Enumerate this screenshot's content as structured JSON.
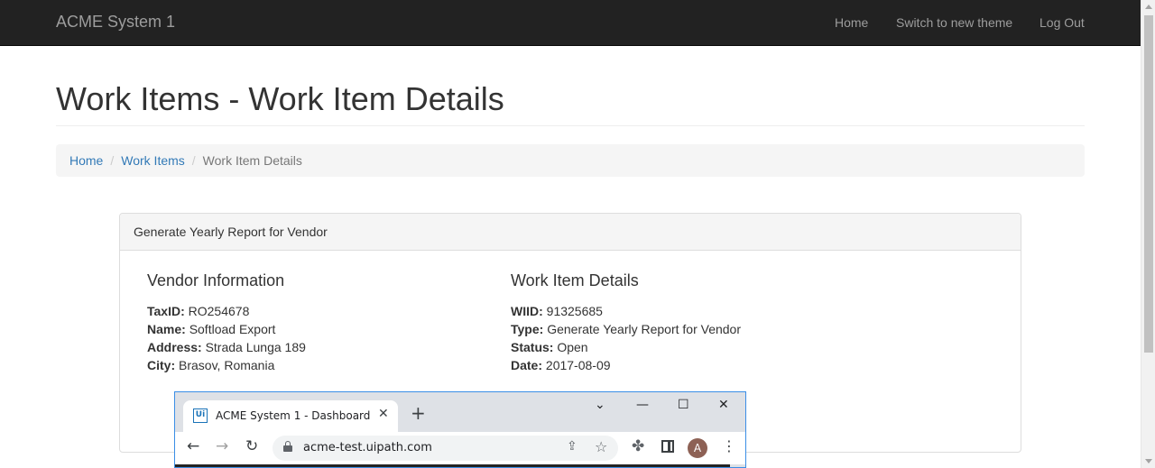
{
  "navbar": {
    "brand": "ACME System 1",
    "links": [
      "Home",
      "Switch to new theme",
      "Log Out"
    ]
  },
  "page": {
    "title": "Work Items - Work Item Details"
  },
  "breadcrumb": {
    "items": [
      "Home",
      "Work Items"
    ],
    "separator": "/",
    "active": "Work Item Details"
  },
  "panel": {
    "heading": "Generate Yearly Report for Vendor",
    "vendor": {
      "title": "Vendor Information",
      "rows": [
        {
          "label": "TaxID:",
          "value": "RO254678"
        },
        {
          "label": "Name:",
          "value": "Softload Export"
        },
        {
          "label": "Address:",
          "value": "Strada Lunga 189"
        },
        {
          "label": "City:",
          "value": "Brasov, Romania"
        }
      ]
    },
    "details": {
      "title": "Work Item Details",
      "rows": [
        {
          "label": "WIID:",
          "value": "91325685"
        },
        {
          "label": "Type:",
          "value": "Generate Yearly Report for Vendor"
        },
        {
          "label": "Status:",
          "value": "Open"
        },
        {
          "label": "Date:",
          "value": "2017-08-09"
        }
      ]
    }
  },
  "browser": {
    "tab_favicon": "Ui",
    "tab_title": "ACME System 1 - Dashboard",
    "url": "acme-test.uipath.com",
    "profile_initial": "A"
  },
  "colors": {
    "navbar_bg": "#222222",
    "link": "#337ab7",
    "browser_accent": "#3a8ee6",
    "avatar": "#8d6155"
  }
}
